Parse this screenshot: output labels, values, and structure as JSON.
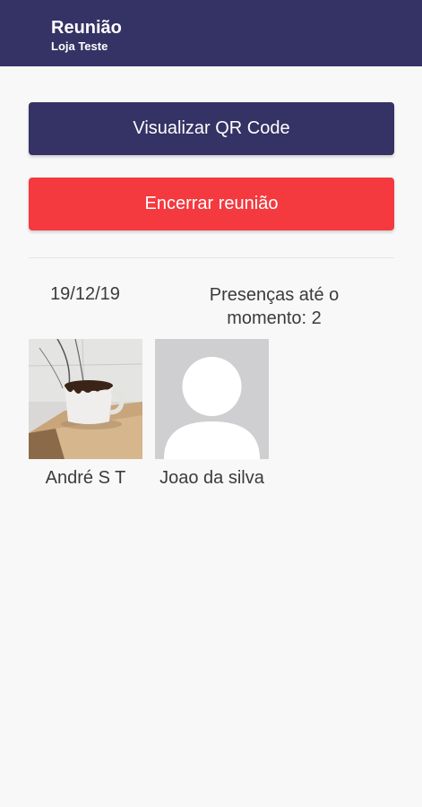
{
  "appbar": {
    "title": "Reunião",
    "subtitle": "Loja Teste"
  },
  "actions": {
    "view_qr_label": "Visualizar QR Code",
    "end_meeting_label": "Encerrar reunião"
  },
  "meeting": {
    "date": "19/12/19",
    "presence_text": "Presenças até o momento: 2"
  },
  "attendees": [
    {
      "name": "André S T",
      "photo": "mug-photo"
    },
    {
      "name": "Joao da silva",
      "photo": "default-avatar"
    }
  ],
  "colors": {
    "primary": "#353265",
    "danger": "#f4393f",
    "background": "#f8f8f9"
  }
}
